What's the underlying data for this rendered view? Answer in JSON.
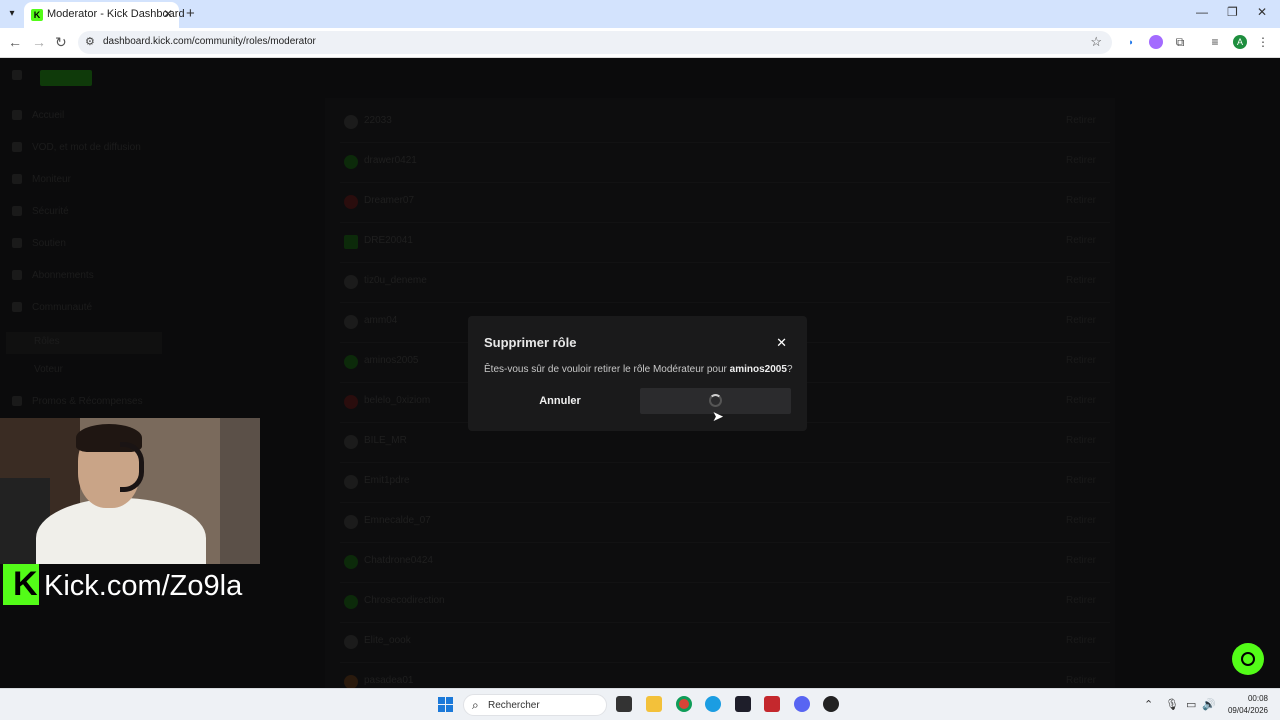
{
  "browser": {
    "tab_title": "Moderator - Kick Dashboard",
    "url": "dashboard.kick.com/community/roles/moderator",
    "profile_initial": "A"
  },
  "sidebar": {
    "items": [
      "Accueil",
      "VOD, et mot de diffusion",
      "Moniteur",
      "Sécurité",
      "Soutien",
      "Abonnements",
      "Communauté",
      "Rôles",
      "Voteur",
      "Promos & Récompenses"
    ]
  },
  "moderators": [
    {
      "name": "22033",
      "action": "Retirer"
    },
    {
      "name": "drawer0421",
      "action": "Retirer"
    },
    {
      "name": "Dreamer07",
      "action": "Retirer"
    },
    {
      "name": "DRE20041",
      "action": "Retirer"
    },
    {
      "name": "tiz0u_deneme",
      "action": "Retirer"
    },
    {
      "name": "amm04",
      "action": "Retirer"
    },
    {
      "name": "aminos2005",
      "action": "Retirer"
    },
    {
      "name": "belelo_0xiziom",
      "action": "Retirer"
    },
    {
      "name": "BILE_MR",
      "action": "Retirer"
    },
    {
      "name": "Emit1pdre",
      "action": "Retirer"
    },
    {
      "name": "Emnecalde_07",
      "action": "Retirer"
    },
    {
      "name": "Chatdrone0424",
      "action": "Retirer"
    },
    {
      "name": "Chrosecodirection",
      "action": "Retirer"
    },
    {
      "name": "Elite_oook",
      "action": "Retirer"
    },
    {
      "name": "pasadea01",
      "action": "Retirer"
    }
  ],
  "dialog": {
    "title": "Supprimer rôle",
    "message_prefix": "Êtes-vous sûr de vouloir retirer le rôle Modérateur pour ",
    "username": "aminos2005",
    "message_suffix": "?",
    "cancel_label": "Annuler"
  },
  "overlay": {
    "channel_text": "Kick.com/Zo9la"
  },
  "taskbar": {
    "search_placeholder": "Rechercher",
    "time": "00:08",
    "date": "09/04/2026"
  },
  "colors": {
    "kick_green": "#53fc18",
    "dialog_bg": "#1a1a1b"
  }
}
